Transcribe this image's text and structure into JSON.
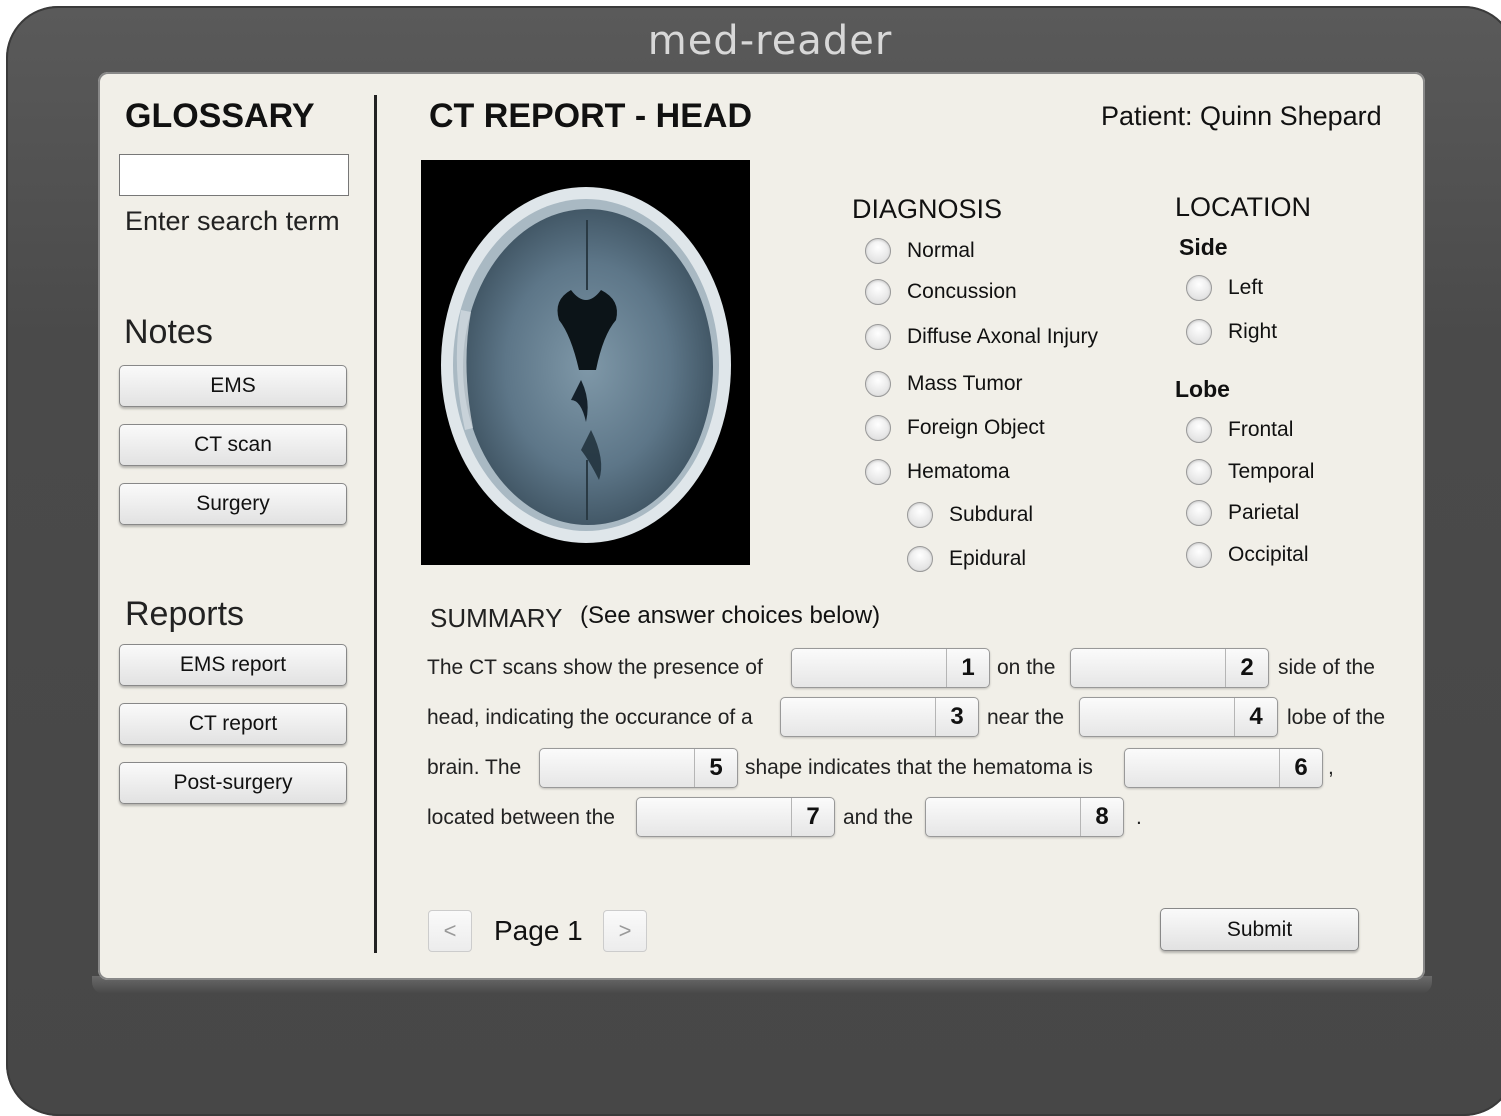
{
  "app": {
    "title": "med-reader"
  },
  "glossary": {
    "title": "GLOSSARY",
    "search_value": "",
    "search_hint": "Enter search term"
  },
  "notes": {
    "title": "Notes",
    "buttons": [
      "EMS",
      "CT scan",
      "Surgery"
    ]
  },
  "reports": {
    "title": "Reports",
    "buttons": [
      "EMS report",
      "CT report",
      "Post-surgery"
    ]
  },
  "header": {
    "title": "CT REPORT - HEAD",
    "patient": "Patient: Quinn Shepard"
  },
  "diagnosis": {
    "title": "DIAGNOSIS",
    "options": [
      "Normal",
      "Concussion",
      "Diffuse Axonal Injury",
      "Mass Tumor",
      "Foreign Object",
      "Hematoma"
    ],
    "sub_options": [
      "Subdural",
      "Epidural"
    ]
  },
  "location": {
    "title": "LOCATION",
    "side_title": "Side",
    "side_options": [
      "Left",
      "Right"
    ],
    "lobe_title": "Lobe",
    "lobe_options": [
      "Frontal",
      "Temporal",
      "Parietal",
      "Occipital"
    ]
  },
  "summary": {
    "title": "SUMMARY",
    "subtitle": "(See answer choices below)",
    "text": {
      "t1": "The CT scans show the presence of",
      "t2": "on the",
      "t3": "side of the",
      "t4": "head, indicating the occurance of a",
      "t5": "near the",
      "t6": "lobe of the",
      "t7": "brain. The",
      "t8": "shape indicates that the hematoma is",
      "t9": ",",
      "t10": "located between the",
      "t11": "and the",
      "t12": "."
    },
    "blanks": [
      "1",
      "2",
      "3",
      "4",
      "5",
      "6",
      "7",
      "8"
    ]
  },
  "pager": {
    "prev": "<",
    "next": ">",
    "page_label": "Page 1"
  },
  "submit_label": "Submit"
}
